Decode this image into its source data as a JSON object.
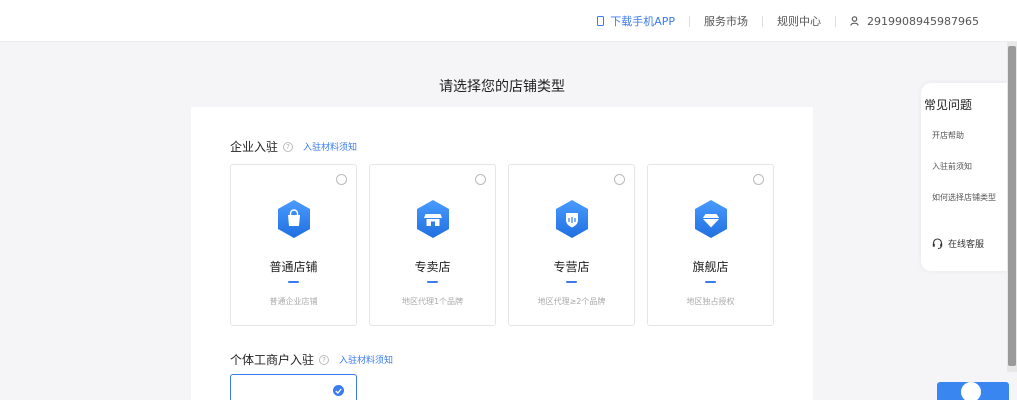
{
  "topnav": {
    "download_app": "下载手机APP",
    "service_market": "服务市场",
    "rules_center": "规则中心",
    "user_id": "2919908945987965"
  },
  "page_title": "请选择您的店铺类型",
  "enterprise": {
    "title": "企业入驻",
    "help_icon": "question-circle-icon",
    "materials_link": "入驻材料须知",
    "cards": [
      {
        "name": "普通店铺",
        "desc": "普通企业店铺",
        "icon": "shopping-bag-icon"
      },
      {
        "name": "专卖店",
        "desc": "地区代理1个品牌",
        "icon": "storefront-icon"
      },
      {
        "name": "专营店",
        "desc": "地区代理≥2个品牌",
        "icon": "shield-icon"
      },
      {
        "name": "旗舰店",
        "desc": "地区独占授权",
        "icon": "diamond-icon"
      }
    ]
  },
  "individual": {
    "title": "个体工商户入驻",
    "help_icon": "question-circle-icon",
    "materials_link": "入驻材料须知"
  },
  "faq": {
    "title": "常见问题",
    "items": [
      "开店帮助",
      "入驻前须知",
      "如何选择店铺类型"
    ],
    "service": "在线客服"
  },
  "colors": {
    "accent": "#3a7bf0",
    "hex_icon": "#2f80ed"
  }
}
